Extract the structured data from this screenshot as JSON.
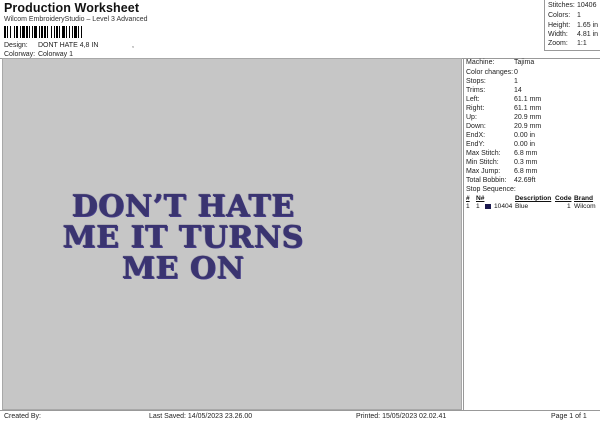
{
  "header": {
    "title": "Production Worksheet",
    "subtitle": "Wilcom EmbroideryStudio – Level 3 Advanced",
    "barcode_suffix": ",",
    "design_label": "Design:",
    "design_value": "DONT HATE 4,8 IN",
    "colorway_label": "Colorway:",
    "colorway_value": "Colorway 1"
  },
  "summary": [
    {
      "label": "Stitches:",
      "value": "10406"
    },
    {
      "label": "Colors:",
      "value": "1"
    },
    {
      "label": "Height:",
      "value": "1.65 in"
    },
    {
      "label": "Width:",
      "value": "4.81 in"
    },
    {
      "label": "Zoom:",
      "value": "1:1"
    }
  ],
  "design": {
    "lines": [
      "DON’T HATE",
      "ME IT TURNS",
      "ME ON"
    ],
    "thread_color": "#3a3470"
  },
  "details": [
    {
      "label": "Machine:",
      "value": "Tajima"
    },
    {
      "label": "Color changes:",
      "value": "0"
    },
    {
      "label": "Stops:",
      "value": "1"
    },
    {
      "label": "Trims:",
      "value": "14"
    },
    {
      "label": "Left:",
      "value": "61.1 mm"
    },
    {
      "label": "Right:",
      "value": "61.1 mm"
    },
    {
      "label": "Up:",
      "value": "20.9 mm"
    },
    {
      "label": "Down:",
      "value": "20.9 mm"
    },
    {
      "label": "EndX:",
      "value": "0.00 in"
    },
    {
      "label": "EndY:",
      "value": "0.00 in"
    },
    {
      "label": "Max Stitch:",
      "value": "6.8 mm"
    },
    {
      "label": "Min Stitch:",
      "value": "0.3 mm"
    },
    {
      "label": "Max Jump:",
      "value": "6.8 mm"
    },
    {
      "label": "Total Bobbin:",
      "value": "42.69ft"
    }
  ],
  "stop_sequence": {
    "label": "Stop Sequence:",
    "columns": [
      "#",
      "N#",
      "",
      "Description",
      "Code",
      "Brand"
    ],
    "rows": [
      {
        "num": "1",
        "n": "1",
        "stitches": "10404",
        "description": "Blue",
        "code": "1",
        "brand": "Wilcom",
        "color": "#1c1a4e"
      }
    ]
  },
  "footer": {
    "created": "Created By:",
    "saved": "Last Saved: 14/05/2023 23.26.00",
    "printed": "Printed: 15/05/2023 02.02.41",
    "page": "Page 1 of 1"
  }
}
